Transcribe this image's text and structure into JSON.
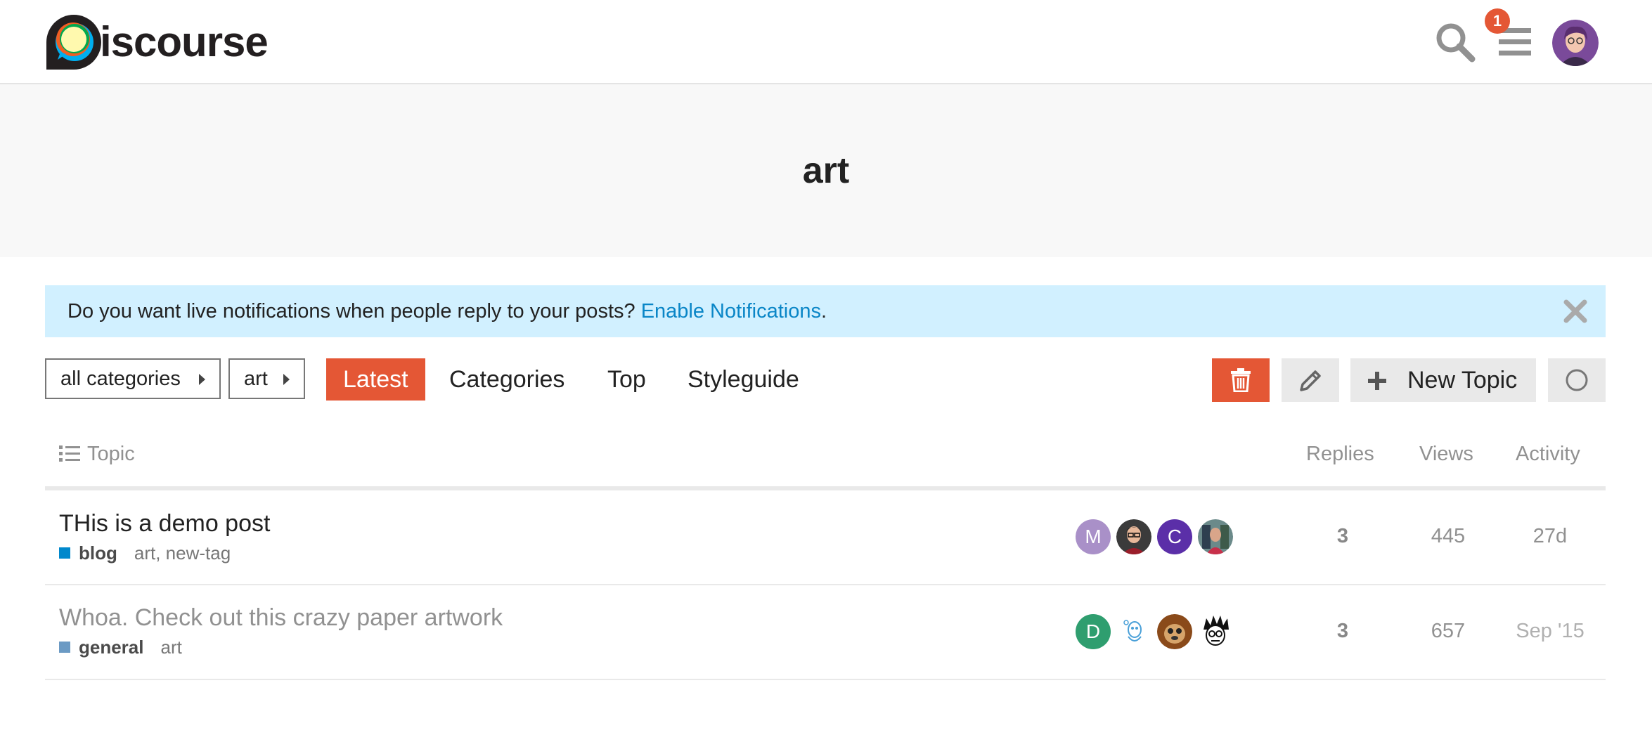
{
  "header": {
    "logo_text": "iscourse",
    "notification_count": "1"
  },
  "category": {
    "title": "art"
  },
  "alert": {
    "text": "Do you want live notifications when people reply to your posts? ",
    "link": "Enable Notifications",
    "suffix": "."
  },
  "nav": {
    "crumbs": [
      "all categories",
      "art"
    ],
    "tabs": [
      "Latest",
      "Categories",
      "Top",
      "Styleguide"
    ],
    "new_topic_label": "New Topic"
  },
  "table": {
    "headers": {
      "topic": "Topic",
      "replies": "Replies",
      "views": "Views",
      "activity": "Activity"
    },
    "rows": [
      {
        "title": "THis is a demo post",
        "category": "blog",
        "category_color": "#0088cc",
        "tags": "art, new-tag",
        "posters": [
          "M",
          "",
          "C",
          ""
        ],
        "replies": "3",
        "views": "445",
        "activity": "27d"
      },
      {
        "title": "Whoa. Check out this crazy paper artwork",
        "category": "general",
        "category_color": "#6b9ac4",
        "tags": "art",
        "posters": [
          "D",
          "",
          "",
          ""
        ],
        "replies": "3",
        "views": "657",
        "activity": "Sep '15"
      }
    ]
  },
  "colors": {
    "accent": "#e45735",
    "link": "#0a86c7",
    "alert_bg": "#d1f0ff"
  }
}
